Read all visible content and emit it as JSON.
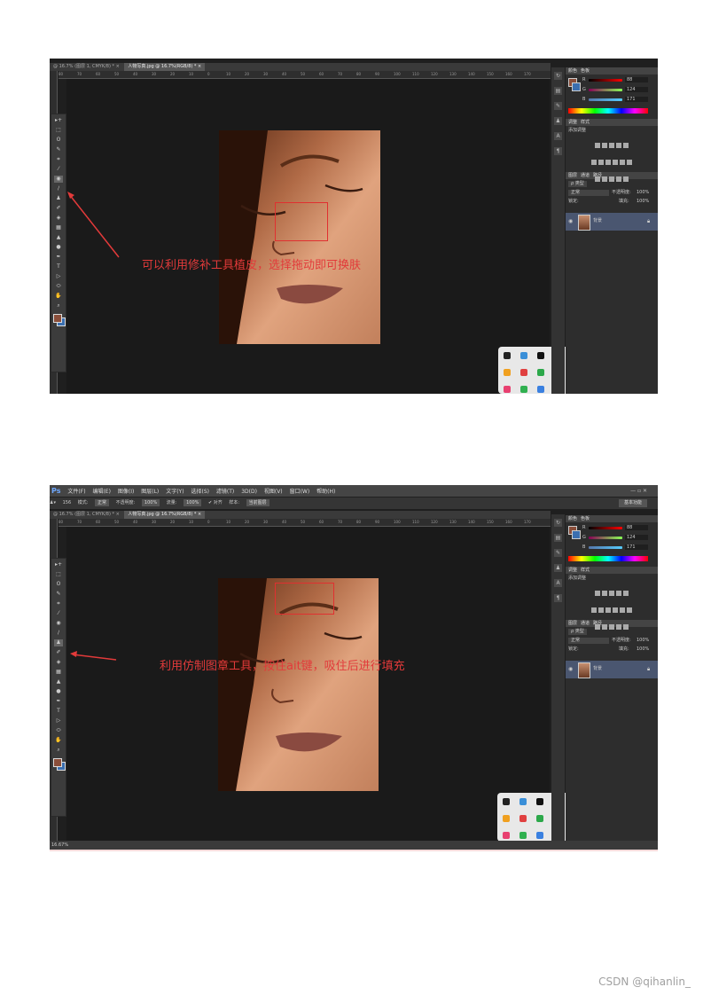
{
  "shot1": {
    "tabs": [
      "@ 16.7% (图层 1, CMYK/8) *  ×",
      "人物写真.jpg @ 16.7%(RGB/8) *  ×"
    ],
    "ruler_ticks": [
      "80",
      "70",
      "60",
      "50",
      "40",
      "30",
      "20",
      "10",
      "0",
      "10",
      "20",
      "30",
      "40",
      "50",
      "60",
      "70",
      "80",
      "90",
      "100",
      "110",
      "120",
      "130",
      "140",
      "150",
      "160",
      "170"
    ],
    "annotation": "可以利用修补工具植皮，选择拖动即可换肤",
    "panel": {
      "color_tabs": [
        "颜色",
        "色板"
      ],
      "r": "88",
      "g": "124",
      "b": "171",
      "adjust_tabs": [
        "调整",
        "样式"
      ],
      "add_adjust": "添加调整",
      "layer_tabs": [
        "图层",
        "通道",
        "路径"
      ],
      "layer_kind": "ρ 类型",
      "blend": "正常",
      "opacity_label": "不透明度:",
      "opacity": "100%",
      "lock_label": "锁定:",
      "fill_label": "填充:",
      "fill": "100%",
      "layer_name": "背景"
    }
  },
  "shot2": {
    "menu": [
      "文件(F)",
      "编辑(E)",
      "图像(I)",
      "图层(L)",
      "文字(Y)",
      "选择(S)",
      "滤镜(T)",
      "3D(D)",
      "视图(V)",
      "窗口(W)",
      "帮助(H)"
    ],
    "logo": "Ps",
    "window_buttons": "— ▫ ✕",
    "options": {
      "brush_size": "156",
      "mode_label": "模式:",
      "mode": "正常",
      "opacity_label": "不透明度:",
      "opacity": "100%",
      "flow_label": "流量:",
      "flow": "100%",
      "aligned": "✔ 对齐",
      "sample_label": "样本:",
      "sample": "当前图层"
    },
    "workspace": "基本功能",
    "tabs": [
      "@ 16.7% (图层 1, CMYK/8) *  ×",
      "人物写真.jpg @ 16.7%(RGB/8) *  ×"
    ],
    "ruler_ticks": [
      "80",
      "70",
      "60",
      "50",
      "40",
      "30",
      "20",
      "10",
      "0",
      "10",
      "20",
      "30",
      "40",
      "50",
      "60",
      "70",
      "80",
      "90",
      "100",
      "110",
      "120",
      "130",
      "140",
      "150",
      "160",
      "170"
    ],
    "annotation": "利用仿制图章工具，按住ait键，吸住后进行填充",
    "status_zoom": "16.67%",
    "panel": {
      "color_tabs": [
        "颜色",
        "色板"
      ],
      "r": "88",
      "g": "124",
      "b": "171",
      "adjust_tabs": [
        "调整",
        "样式"
      ],
      "add_adjust": "添加调整",
      "layer_tabs": [
        "图层",
        "通道",
        "路径"
      ],
      "layer_kind": "ρ 类型",
      "blend": "正常",
      "opacity_label": "不透明度:",
      "opacity": "100%",
      "lock_label": "锁定:",
      "fill_label": "填充:",
      "fill": "100%",
      "layer_name": "背景"
    }
  },
  "tools": [
    "▸+",
    "⬚",
    "ʘ",
    "✎",
    "⌗",
    "⁄",
    "◉",
    "∕",
    "♟",
    "✐",
    "◈",
    "▦",
    "▲",
    "●",
    "✒",
    "T",
    "▷",
    "⬭",
    "✋",
    "⌕"
  ],
  "accent_colors": {
    "annotation": "#e23a3a",
    "layer_selected": "#4a5670"
  },
  "footer": "CSDN @qihanlin_"
}
